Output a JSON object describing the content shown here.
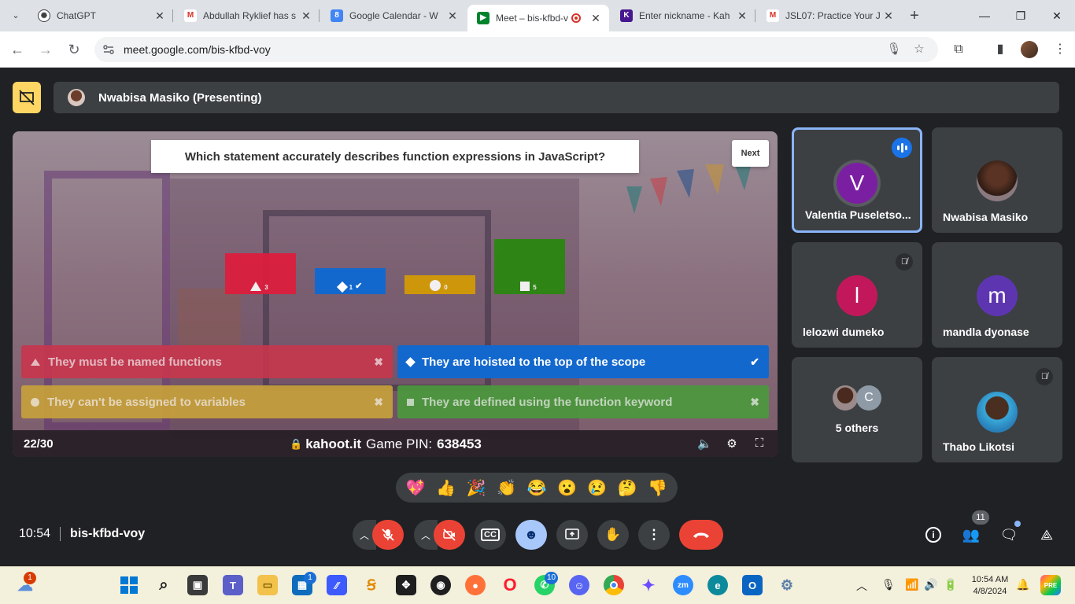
{
  "browser": {
    "tabs": [
      {
        "title": "ChatGPT",
        "favicon": "chatgpt-icon"
      },
      {
        "title": "Abdullah Ryklief has s",
        "favicon": "gmail-icon"
      },
      {
        "title": "Google Calendar - W",
        "favicon": "calendar-icon"
      },
      {
        "title": "Meet – bis-kfbd-v",
        "favicon": "meet-icon",
        "active": true
      },
      {
        "title": "Enter nickname - Kah",
        "favicon": "kahoot-icon"
      },
      {
        "title": "JSL07: Practice Your J",
        "favicon": "gmail-icon"
      }
    ],
    "url": "meet.google.com/bis-kfbd-voy"
  },
  "meet": {
    "presenter": "Nwabisa Masiko (Presenting)",
    "kahoot": {
      "question": "Which statement accurately describes function expressions in JavaScript?",
      "next_label": "Next",
      "results": [
        {
          "shape": "triangle",
          "count": "3",
          "color": "#e21b3c",
          "fraction": 0.6
        },
        {
          "shape": "diamond",
          "count": "1",
          "color": "#1368ce",
          "fraction": 0.2,
          "correct": true
        },
        {
          "shape": "circle",
          "count": "0",
          "color": "#d89e00",
          "fraction": 0.0
        },
        {
          "shape": "square",
          "count": "5",
          "color": "#26890c",
          "fraction": 1.0
        }
      ],
      "answers": [
        {
          "text": "They must be named functions",
          "shape": "triangle",
          "mark": "✖",
          "color": "#e21b3c"
        },
        {
          "text": "They are hoisted to the top of the scope",
          "shape": "diamond",
          "mark": "✔",
          "color": "#1368ce"
        },
        {
          "text": "They can't be assigned to variables",
          "shape": "circle",
          "mark": "✖",
          "color": "#d89e00"
        },
        {
          "text": "They are defined using the function keyword",
          "shape": "square",
          "mark": "✖",
          "color": "#26890c"
        }
      ],
      "question_counter": "22/30",
      "site": "kahoot.it",
      "pin_label": "Game PIN:",
      "pin": "638453"
    },
    "participants": [
      {
        "name": "Valentia Puseletso...",
        "initial": "V",
        "color": "#7b1fa2",
        "speaking": true
      },
      {
        "name": "Nwabisa Masiko",
        "initial": "",
        "photo": true
      },
      {
        "name": "lelozwi dumeko",
        "initial": "l",
        "color": "#c2185b",
        "muted": true
      },
      {
        "name": "mandla dyonase",
        "initial": "m",
        "color": "#5e35b1"
      },
      {
        "name": "5 others",
        "initial": "C",
        "group": true
      },
      {
        "name": "Thabo Likotsi",
        "initial": "",
        "photo": true,
        "muted": true
      }
    ],
    "reactions": [
      "💖",
      "👍",
      "🎉",
      "👏",
      "😂",
      "😮",
      "😢",
      "🤔",
      "👎"
    ],
    "time": "10:54",
    "meeting_code": "bis-kfbd-voy",
    "people_count": "11"
  },
  "taskbar": {
    "weather_badge": "1",
    "store_badge": "1",
    "whatsapp_badge": "10",
    "clock_time": "10:54 AM",
    "clock_date": "4/8/2024"
  }
}
